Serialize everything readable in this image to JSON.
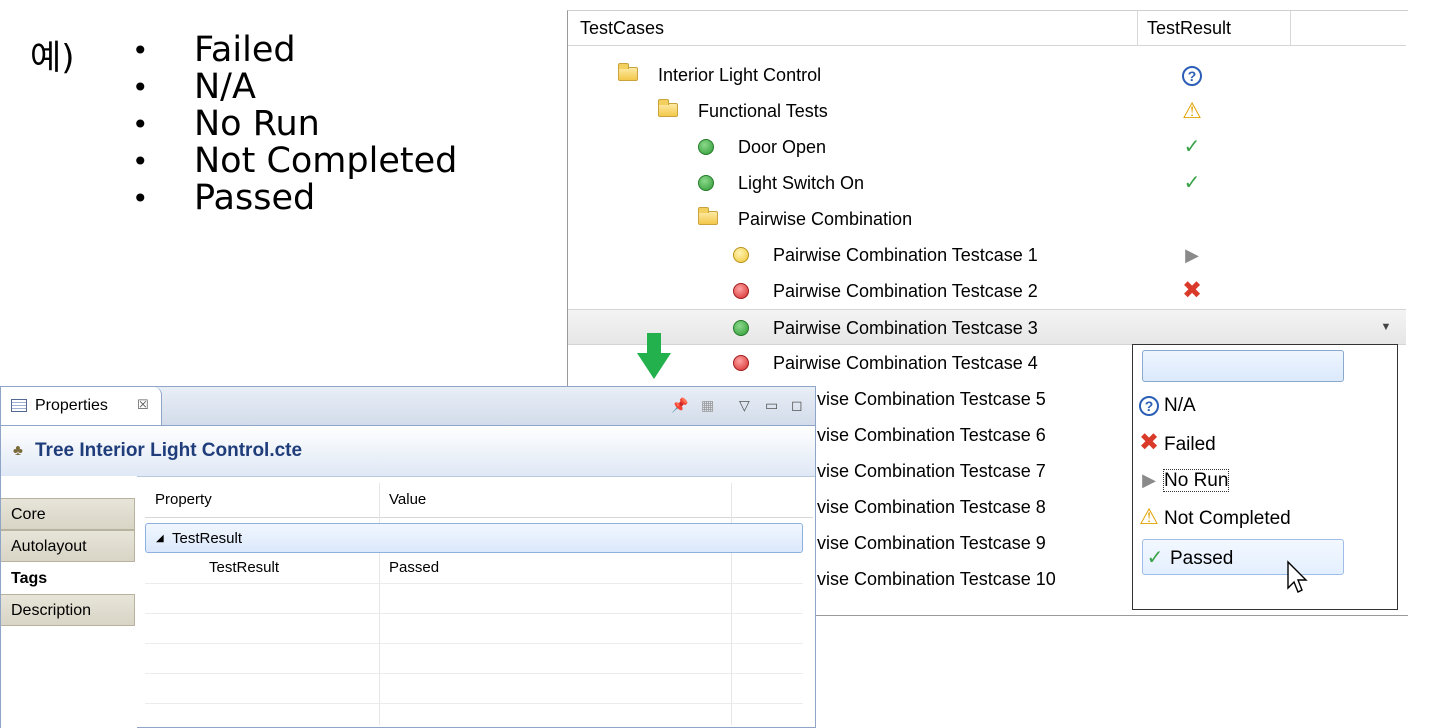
{
  "example_prefix": "예)",
  "bullets": [
    "Failed",
    "N/A",
    "No Run",
    "Not Completed",
    "Passed"
  ],
  "tree": {
    "headers": {
      "cases": "TestCases",
      "result": "TestResult"
    },
    "rows": [
      {
        "label": "Interior Light Control",
        "icon": "folder-icon",
        "result": "n/a-icon"
      },
      {
        "label": "Functional Tests",
        "icon": "folder-icon",
        "result": "warning-icon"
      },
      {
        "label": "Door Open",
        "icon": "green-dot-icon",
        "result": "check-icon"
      },
      {
        "label": "Light Switch On",
        "icon": "green-dot-icon",
        "result": "check-icon"
      },
      {
        "label": "Pairwise Combination",
        "icon": "folder-icon",
        "result": ""
      },
      {
        "label": "Pairwise Combination Testcase 1",
        "icon": "yellow-dot-icon",
        "result": "play-icon"
      },
      {
        "label": "Pairwise Combination Testcase 2",
        "icon": "red-dot-icon",
        "result": "failed-x-icon"
      },
      {
        "label": "Pairwise Combination Testcase 3",
        "icon": "green-dot-icon",
        "result": "",
        "selected": true
      },
      {
        "label": "Pairwise Combination Testcase 4",
        "icon": "red-dot-icon",
        "result": ""
      }
    ],
    "partial_rows": [
      "vise Combination Testcase 5",
      "vise Combination Testcase 6",
      "vise Combination Testcase 7",
      "vise Combination Testcase 8",
      "vise Combination Testcase 9",
      "vise Combination Testcase 10"
    ]
  },
  "dropdown": {
    "input_value": "",
    "options": [
      {
        "label": "N/A",
        "icon": "question-icon"
      },
      {
        "label": "Failed",
        "icon": "failed-x-icon"
      },
      {
        "label": "No Run",
        "icon": "play-icon",
        "focused": true
      },
      {
        "label": "Not Completed",
        "icon": "warning-icon"
      },
      {
        "label": "Passed",
        "icon": "check-icon",
        "hover": true
      }
    ]
  },
  "properties": {
    "tab_label": "Properties",
    "tab_close": "☒",
    "title": "Tree Interior Light Control.cte",
    "side_tabs": [
      "Core",
      "Autolayout",
      "Tags",
      "Description"
    ],
    "active_side_tab": "Tags",
    "columns": [
      "Property",
      "Value"
    ],
    "group_label": "TestResult",
    "group_toggle": "◢",
    "row_property": "TestResult",
    "row_value": "Passed"
  },
  "colors": {
    "accent": "#1f3d7a",
    "arrow": "#22b14c",
    "failed": "#d93a2a",
    "passed": "#3aa34a"
  }
}
